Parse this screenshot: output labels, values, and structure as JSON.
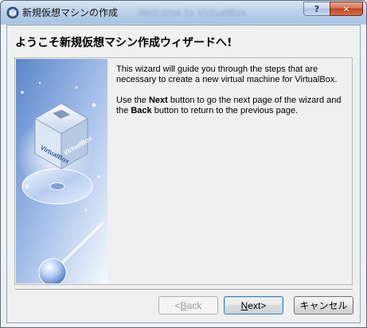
{
  "window": {
    "title": "新規仮想マシンの作成",
    "background_window_title": "Welcome to VirtualBox",
    "help_label": "?",
    "close_label": "✕"
  },
  "wizard": {
    "heading": "ようこそ新規仮想マシン作成ウィザードへ!",
    "paragraph1": "This wizard will guide you through the steps that are necessary to create a new virtual machine for VirtualBox.",
    "p2_prefix": "Use the ",
    "p2_next": "Next",
    "p2_middle": " button to go the next page of the wizard and the ",
    "p2_back": "Back",
    "p2_suffix": " button to return to the previous page.",
    "image_label_front": "VirtualBox",
    "image_label_side": "VirtualBox"
  },
  "buttons": {
    "back_arrow": "< ",
    "back_mnemonic": "B",
    "back_rest": "ack",
    "next_mnemonic": "N",
    "next_rest": "ext",
    "next_arrow": " >",
    "cancel_label": "キャンセル"
  },
  "colors": {
    "title_gradient_top": "#d9e7f6",
    "close_button": "#c0441f",
    "default_button_border": "#3c7fb1"
  }
}
